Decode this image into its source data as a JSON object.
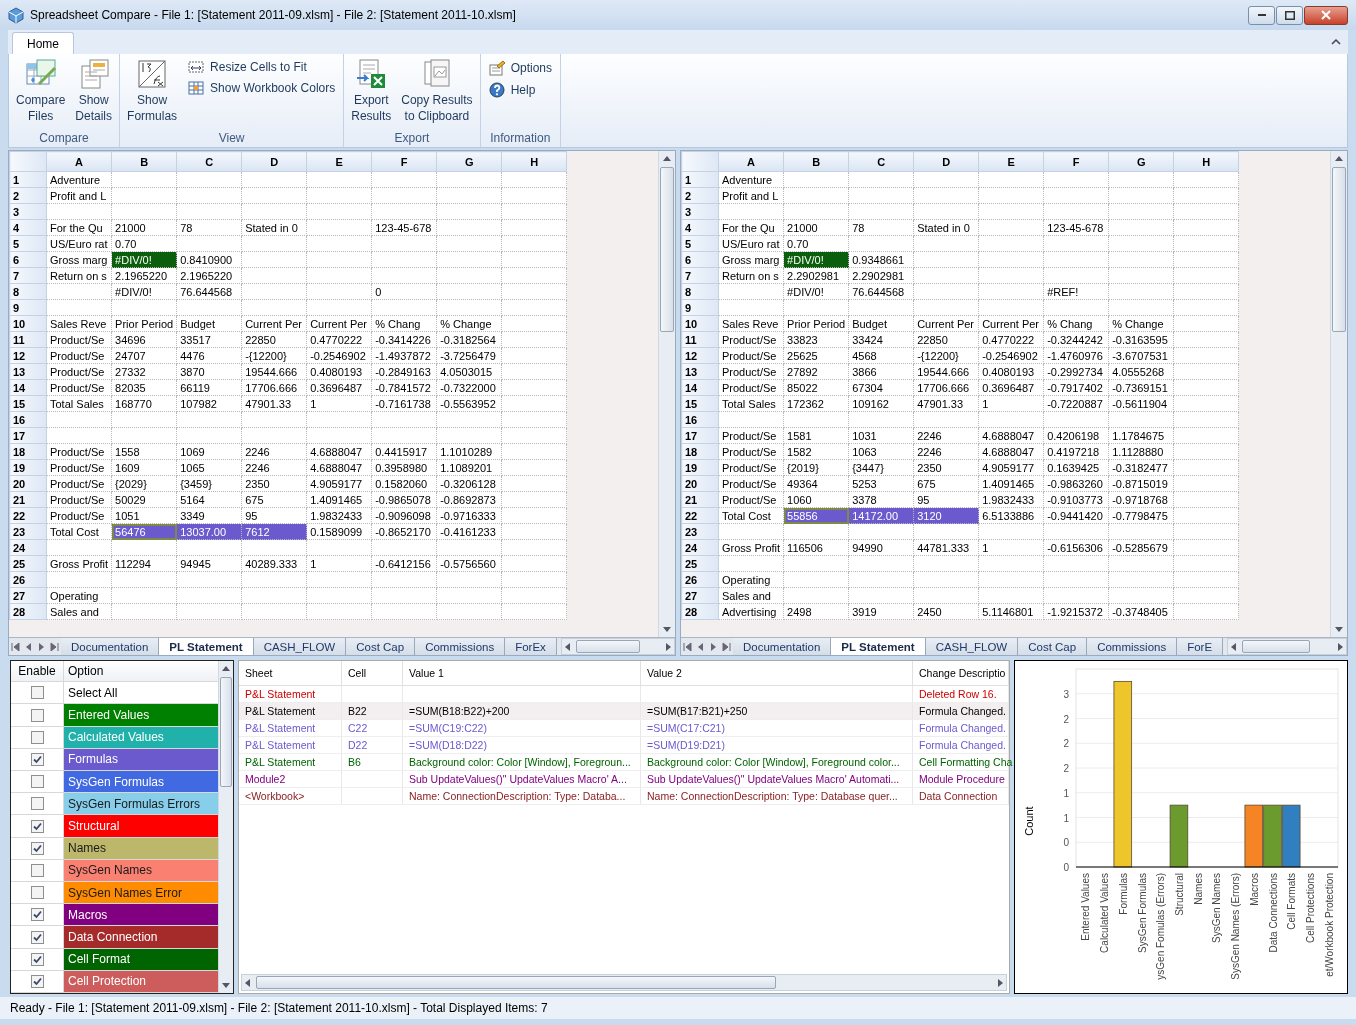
{
  "window": {
    "title": "Spreadsheet Compare - File 1: [Statement 2011-09.xlsm] - File 2: [Statement 2011-10.xlsm]"
  },
  "ribbon": {
    "tabs": [
      {
        "label": "Home",
        "selected": true
      }
    ],
    "groups": [
      {
        "label": "Compare",
        "items": [
          {
            "kind": "large",
            "label": "Compare\nFiles"
          },
          {
            "kind": "large",
            "label": "Show\nDetails"
          }
        ]
      },
      {
        "label": "View",
        "items": [
          {
            "kind": "large",
            "label": "Show\nFormulas"
          },
          {
            "kind": "small",
            "label": "Resize Cells to Fit"
          },
          {
            "kind": "small",
            "label": "Show Workbook Colors"
          }
        ]
      },
      {
        "label": "Export",
        "items": [
          {
            "kind": "large",
            "label": "Export\nResults"
          },
          {
            "kind": "large",
            "label": "Copy Results\nto Clipboard"
          }
        ]
      },
      {
        "label": "Information",
        "items": [
          {
            "kind": "small",
            "label": "Options"
          },
          {
            "kind": "small",
            "label": "Help"
          }
        ]
      }
    ]
  },
  "sheets": [
    {
      "columns": [
        "A",
        "B",
        "C",
        "D",
        "E",
        "F",
        "G",
        "H"
      ],
      "rows": [
        {
          "num": "1",
          "cells": {
            "A": "Adventure"
          }
        },
        {
          "num": "2",
          "cells": {
            "A": "Profit and L"
          }
        },
        {
          "num": "3",
          "cells": {}
        },
        {
          "num": "4",
          "cells": {
            "A": "For the Qu",
            "B": "21000",
            "C": "78",
            "D": "Stated in 0",
            "F": "123-45-678"
          }
        },
        {
          "num": "5",
          "cells": {
            "A": "US/Euro rat",
            "B": "0.70"
          }
        },
        {
          "num": "6",
          "cells": {
            "A": "Gross marg",
            "B": {
              "text": "#DIV/0!",
              "color": "#0b5e0b",
              "selected": false
            },
            "C": "0.8410900"
          }
        },
        {
          "num": "7",
          "cells": {
            "A": "Return on s",
            "B": "2.1965220",
            "C": "2.1965220"
          }
        },
        {
          "num": "8",
          "cells": {
            "B": "#DIV/0!",
            "C": "76.644568",
            "F": "0"
          }
        },
        {
          "num": "9",
          "cells": {}
        },
        {
          "num": "10",
          "cells": {
            "A": "Sales Reve",
            "B": "Prior Period",
            "C": "Budget",
            "D": "Current Per",
            "E": "Current Per",
            "F": "% Chang",
            "G": "% Change"
          }
        },
        {
          "num": "11",
          "cells": {
            "A": "Product/Se",
            "B": "34696",
            "C": "33517",
            "D": "22850",
            "E": "0.4770222",
            "F": "-0.3414226",
            "G": "-0.3182564"
          }
        },
        {
          "num": "12",
          "cells": {
            "A": "Product/Se",
            "B": "24707",
            "C": "4476",
            "D": "-{12200}",
            "E": "-0.2546902",
            "F": "-1.4937872",
            "G": "-3.7256479"
          }
        },
        {
          "num": "13",
          "cells": {
            "A": "Product/Se",
            "B": "27332",
            "C": "3870",
            "D": "19544.666",
            "E": "0.4080193",
            "F": "-0.2849163",
            "G": "4.0503015"
          }
        },
        {
          "num": "14",
          "cells": {
            "A": "Product/Se",
            "B": "82035",
            "C": "66119",
            "D": "17706.666",
            "E": "0.3696487",
            "F": "-0.7841572",
            "G": "-0.7322000"
          }
        },
        {
          "num": "15",
          "cells": {
            "A": "Total Sales",
            "B": "168770",
            "C": "107982",
            "D": "47901.33",
            "E": "1",
            "F": "-0.7161738",
            "G": "-0.5563952"
          }
        },
        {
          "num": "16",
          "cells": {}
        },
        {
          "num": "17",
          "cells": {}
        },
        {
          "num": "18",
          "cells": {
            "A": "Product/Se",
            "B": "1558",
            "C": "1069",
            "D": "2246",
            "E": "4.6888047",
            "F": "0.4415917",
            "G": "1.1010289"
          }
        },
        {
          "num": "19",
          "cells": {
            "A": "Product/Se",
            "B": "1609",
            "C": "1065",
            "D": "2246",
            "E": "4.6888047",
            "F": "0.3958980",
            "G": "1.1089201"
          }
        },
        {
          "num": "20",
          "cells": {
            "A": "Product/Se",
            "B": "{2029}",
            "C": "{3459}",
            "D": "2350",
            "E": "4.9059177",
            "F": "0.1582060",
            "G": "-0.3206128"
          }
        },
        {
          "num": "21",
          "cells": {
            "A": "Product/Se",
            "B": "50029",
            "C": "5164",
            "D": "675",
            "E": "1.4091465",
            "F": "-0.9865078",
            "G": "-0.8692873"
          }
        },
        {
          "num": "22",
          "cells": {
            "A": "Product/Se",
            "B": "1051",
            "C": "3349",
            "D": "95",
            "E": "1.9832433",
            "F": "-0.9096098",
            "G": "-0.9716333"
          }
        },
        {
          "num": "23",
          "cells": {
            "A": "Total Cost",
            "B": {
              "text": "56476",
              "color": "#6a5acd",
              "selected": true
            },
            "C": {
              "text": "13037.00",
              "color": "#6a5acd",
              "selected": false
            },
            "D": {
              "text": "7612",
              "color": "#6a5acd",
              "selected": false
            },
            "E": "0.1589099",
            "F": "-0.8652170",
            "G": "-0.4161233"
          }
        },
        {
          "num": "24",
          "cells": {}
        },
        {
          "num": "25",
          "cells": {
            "A": "Gross Profit",
            "B": "112294",
            "C": "94945",
            "D": "40289.333",
            "E": "1",
            "F": "-0.6412156",
            "G": "-0.5756560"
          }
        },
        {
          "num": "26",
          "cells": {}
        },
        {
          "num": "27",
          "cells": {
            "A": "Operating"
          }
        },
        {
          "num": "28",
          "cells": {
            "A": "Sales and"
          }
        }
      ],
      "tabs": [
        {
          "label": "Documentation",
          "selected": false
        },
        {
          "label": "PL Statement",
          "selected": true
        },
        {
          "label": "CASH_FLOW",
          "selected": false
        },
        {
          "label": "Cost Cap",
          "selected": false
        },
        {
          "label": "Commissions",
          "selected": false
        },
        {
          "label": "ForEx",
          "selected": false
        }
      ]
    },
    {
      "columns": [
        "A",
        "B",
        "C",
        "D",
        "E",
        "F",
        "G",
        "H"
      ],
      "rows": [
        {
          "num": "1",
          "cells": {
            "A": "Adventure"
          }
        },
        {
          "num": "2",
          "cells": {
            "A": "Profit and L"
          }
        },
        {
          "num": "3",
          "cells": {}
        },
        {
          "num": "4",
          "cells": {
            "A": "For the Qu",
            "B": "21000",
            "C": "78",
            "D": "Stated in 0",
            "F": "123-45-678"
          }
        },
        {
          "num": "5",
          "cells": {
            "A": "US/Euro rat",
            "B": "0.70"
          }
        },
        {
          "num": "6",
          "cells": {
            "A": "Gross marg",
            "B": {
              "text": "#DIV/0!",
              "color": "#0b5e0b",
              "selected": false
            },
            "C": "0.9348661"
          }
        },
        {
          "num": "7",
          "cells": {
            "A": "Return on s",
            "B": "2.2902981",
            "C": "2.2902981"
          }
        },
        {
          "num": "8",
          "cells": {
            "B": "#DIV/0!",
            "C": "76.644568",
            "F": "#REF!"
          }
        },
        {
          "num": "9",
          "cells": {}
        },
        {
          "num": "10",
          "cells": {
            "A": "Sales Reve",
            "B": "Prior Period",
            "C": "Budget",
            "D": "Current Per",
            "E": "Current Per",
            "F": "% Chang",
            "G": "% Change"
          }
        },
        {
          "num": "11",
          "cells": {
            "A": "Product/Se",
            "B": "33823",
            "C": "33424",
            "D": "22850",
            "E": "0.4770222",
            "F": "-0.3244242",
            "G": "-0.3163595"
          }
        },
        {
          "num": "12",
          "cells": {
            "A": "Product/Se",
            "B": "25625",
            "C": "4568",
            "D": "-{12200}",
            "E": "-0.2546902",
            "F": "-1.4760976",
            "G": "-3.6707531"
          }
        },
        {
          "num": "13",
          "cells": {
            "A": "Product/Se",
            "B": "27892",
            "C": "3866",
            "D": "19544.666",
            "E": "0.4080193",
            "F": "-0.2992734",
            "G": "4.0555268"
          }
        },
        {
          "num": "14",
          "cells": {
            "A": "Product/Se",
            "B": "85022",
            "C": "67304",
            "D": "17706.666",
            "E": "0.3696487",
            "F": "-0.7917402",
            "G": "-0.7369151"
          }
        },
        {
          "num": "15",
          "cells": {
            "A": "Total Sales",
            "B": "172362",
            "C": "109162",
            "D": "47901.33",
            "E": "1",
            "F": "-0.7220887",
            "G": "-0.5611904"
          }
        },
        {
          "num": "16",
          "cells": {}
        },
        {
          "num": "17",
          "cells": {
            "A": "Product/Se",
            "B": "1581",
            "C": "1031",
            "D": "2246",
            "E": "4.6888047",
            "F": "0.4206198",
            "G": "1.1784675"
          }
        },
        {
          "num": "18",
          "cells": {
            "A": "Product/Se",
            "B": "1582",
            "C": "1063",
            "D": "2246",
            "E": "4.6888047",
            "F": "0.4197218",
            "G": "1.1128880"
          }
        },
        {
          "num": "19",
          "cells": {
            "A": "Product/Se",
            "B": "{2019}",
            "C": "{3447}",
            "D": "2350",
            "E": "4.9059177",
            "F": "0.1639425",
            "G": "-0.3182477"
          }
        },
        {
          "num": "20",
          "cells": {
            "A": "Product/Se",
            "B": "49364",
            "C": "5253",
            "D": "675",
            "E": "1.4091465",
            "F": "-0.9863260",
            "G": "-0.8715019"
          }
        },
        {
          "num": "21",
          "cells": {
            "A": "Product/Se",
            "B": "1060",
            "C": "3378",
            "D": "95",
            "E": "1.9832433",
            "F": "-0.9103773",
            "G": "-0.9718768"
          }
        },
        {
          "num": "22",
          "cells": {
            "A": "Total Cost",
            "B": {
              "text": "55856",
              "color": "#6a5acd",
              "selected": true
            },
            "C": {
              "text": "14172.00",
              "color": "#6a5acd",
              "selected": false
            },
            "D": {
              "text": "3120",
              "color": "#6a5acd",
              "selected": false
            },
            "E": "6.5133886",
            "F": "-0.9441420",
            "G": "-0.7798475"
          }
        },
        {
          "num": "23",
          "cells": {}
        },
        {
          "num": "24",
          "cells": {
            "A": "Gross Profit",
            "B": "116506",
            "C": "94990",
            "D": "44781.333",
            "E": "1",
            "F": "-0.6156306",
            "G": "-0.5285679"
          }
        },
        {
          "num": "25",
          "cells": {}
        },
        {
          "num": "26",
          "cells": {
            "A": "Operating"
          }
        },
        {
          "num": "27",
          "cells": {
            "A": "Sales and"
          }
        },
        {
          "num": "28",
          "cells": {
            "A": "Advertising",
            "B": "2498",
            "C": "3919",
            "D": "2450",
            "E": "5.1146801",
            "F": "-1.9215372",
            "G": "-0.3748405"
          }
        }
      ],
      "tabs": [
        {
          "label": "Documentation",
          "selected": false
        },
        {
          "label": "PL Statement",
          "selected": true
        },
        {
          "label": "CASH_FLOW",
          "selected": false
        },
        {
          "label": "Cost Cap",
          "selected": false
        },
        {
          "label": "Commissions",
          "selected": false
        },
        {
          "label": "ForE",
          "selected": false
        }
      ]
    }
  ],
  "options": {
    "columns": [
      "Enable",
      "Option"
    ],
    "items": [
      {
        "label": "Select All",
        "checked": false
      },
      {
        "label": "Entered Values",
        "checked": false,
        "color": "#008000"
      },
      {
        "label": "Calculated Values",
        "checked": false,
        "color": "#20b2aa"
      },
      {
        "label": "Formulas",
        "checked": true,
        "color": "#6a5acd"
      },
      {
        "label": "SysGen Formulas",
        "checked": false,
        "color": "#4169e1"
      },
      {
        "label": "SysGen Formulas Errors",
        "checked": false,
        "color": "#87ceeb"
      },
      {
        "label": "Structural",
        "checked": true,
        "color": "#ff0000"
      },
      {
        "label": "Names",
        "checked": true,
        "color": "#bdb76b"
      },
      {
        "label": "SysGen Names",
        "checked": false,
        "color": "#fa8072"
      },
      {
        "label": "SysGen Names Error",
        "checked": false,
        "color": "#ff8c00"
      },
      {
        "label": "Macros",
        "checked": true,
        "color": "#800080"
      },
      {
        "label": "Data Connection",
        "checked": true,
        "color": "#a52a2a"
      },
      {
        "label": "Cell Format",
        "checked": true,
        "color": "#006400"
      },
      {
        "label": "Cell Protection",
        "checked": true,
        "color": "#cd5c5c"
      }
    ]
  },
  "changes": {
    "columns": [
      "Sheet",
      "Cell",
      "Value 1",
      "Value 2",
      "Change Descriptio"
    ],
    "rows": [
      {
        "sheet": "P&L Statement",
        "description": "Deleted Row 16.",
        "color": "#cc0000",
        "selected": false
      },
      {
        "sheet": "P&L Statement",
        "cell": "B22",
        "value_1": "=SUM(B18:B22)+200",
        "value_2": "=SUM(B17:B21)+250",
        "description": "Formula Changed.",
        "color": "#000000",
        "selected": true
      },
      {
        "sheet": "P&L Statement",
        "cell": "C22",
        "value_1": "=SUM(C19:C22)",
        "value_2": "=SUM(C17:C21)",
        "description": "Formula Changed.",
        "color": "#6a5acd",
        "selected": false
      },
      {
        "sheet": "P&L Statement",
        "cell": "D22",
        "value_1": "=SUM(D18:D22)",
        "value_2": "=SUM(D19:D21)",
        "description": "Formula Changed.",
        "color": "#6a5acd",
        "selected": false
      },
      {
        "sheet": "P&L Statement",
        "cell": "B6",
        "value_1": "Background color: Color [Window], Foregroun...",
        "value_2": "Background color: Color [Window], Foreground color...",
        "description": "Cell Formatting Cha",
        "color": "#006400",
        "selected": false
      },
      {
        "sheet": "Module2",
        "value_1": "Sub UpdateValues()\" UpdateValues Macro' A...",
        "value_2": "Sub UpdateValues()\" UpdateValues Macro' Automati...",
        "description": "Module Procedure",
        "color": "#800080",
        "selected": false
      },
      {
        "sheet": "<Workbook>",
        "value_1": "Name: ConnectionDescription: Type: Databa...",
        "value_2": "Name: ConnectionDescription: Type: Database quer...",
        "description": "Data Connection",
        "color": "#8b2222",
        "selected": false
      }
    ]
  },
  "summary": {
    "chart_data": {
      "type": "bar",
      "ylabel": "Count",
      "stacked": true,
      "grid": true,
      "categories": [
        "Entered Values",
        "Calculated Values",
        "Formulas",
        "SysGen Formulas",
        "ysGen Fomulas (Errors)",
        "Structural",
        "Names",
        "SysGen Names",
        "SysGen Names (Errors)",
        "Macros",
        "Data Connections",
        "Cell Formats",
        "Cell Protections",
        "et/Workbook Protection"
      ],
      "ylim": [
        0,
        3.2
      ],
      "yticks": [
        {
          "value": 0,
          "label": "0"
        },
        {
          "value": 0.4,
          "label": "0"
        },
        {
          "value": 0.8,
          "label": "1"
        },
        {
          "value": 1.2,
          "label": "1"
        },
        {
          "value": 1.6,
          "label": "2"
        },
        {
          "value": 2.0,
          "label": "2"
        },
        {
          "value": 2.4,
          "label": "2"
        },
        {
          "value": 2.8,
          "label": "3"
        }
      ],
      "series": [
        {
          "color": "#eec52a",
          "values": [
            null,
            null,
            3,
            null,
            null,
            null,
            null,
            null,
            null,
            null,
            null,
            null,
            null,
            null
          ]
        },
        {
          "color": "#6b9a2e",
          "values": [
            null,
            null,
            null,
            null,
            null,
            1,
            null,
            null,
            null,
            null,
            null,
            null,
            null,
            null
          ]
        },
        {
          "color": "#f58524",
          "values": [
            null,
            null,
            null,
            null,
            null,
            null,
            null,
            null,
            null,
            1,
            null,
            null,
            null,
            null
          ]
        },
        {
          "color": "#6b9a2e",
          "values": [
            null,
            null,
            null,
            null,
            null,
            null,
            null,
            null,
            null,
            null,
            1,
            null,
            null,
            null
          ]
        },
        {
          "color": "#2f7fc1",
          "values": [
            null,
            null,
            null,
            null,
            null,
            null,
            null,
            null,
            null,
            null,
            null,
            1,
            null,
            null
          ]
        }
      ]
    }
  },
  "status_bar": "Ready - File 1: [Statement 2011-09.xlsm] - File 2: [Statement 2011-10.xlsm] - Total Displayed Items: 7"
}
